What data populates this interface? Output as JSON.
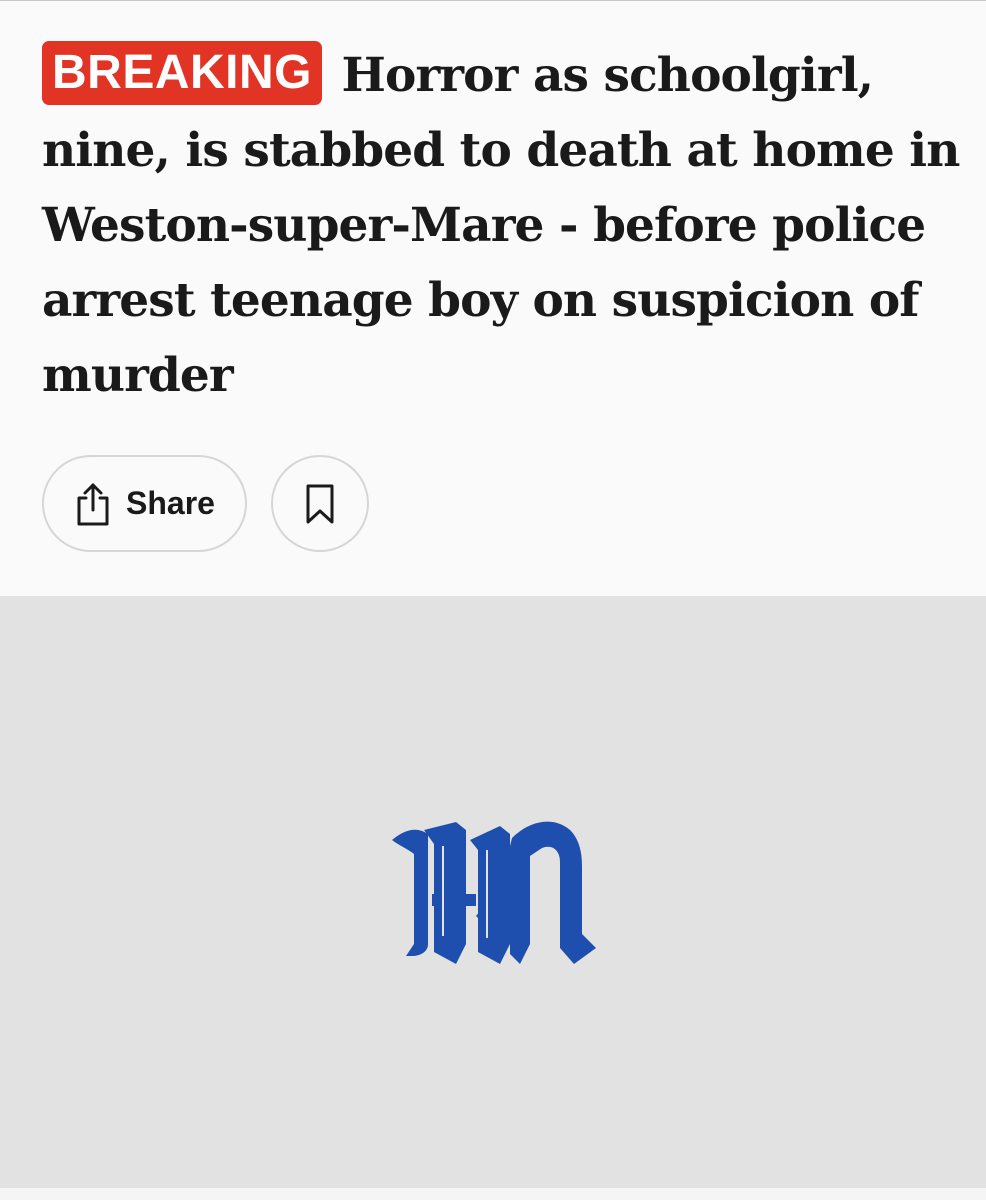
{
  "article": {
    "badge": "BREAKING",
    "headline": "Horror as schoolgirl, nine, is stabbed to death at home in Weston-super-Mare - before police arrest teenage boy on suspicion of murder"
  },
  "actions": {
    "share_label": "Share",
    "share_icon": "share-icon",
    "bookmark_icon": "bookmark-icon"
  },
  "media": {
    "placeholder_logo": "masthead-m-logo"
  },
  "colors": {
    "badge_bg": "#e23424",
    "logo_blue": "#1f4fae",
    "placeholder_bg": "#e2e2e2"
  }
}
